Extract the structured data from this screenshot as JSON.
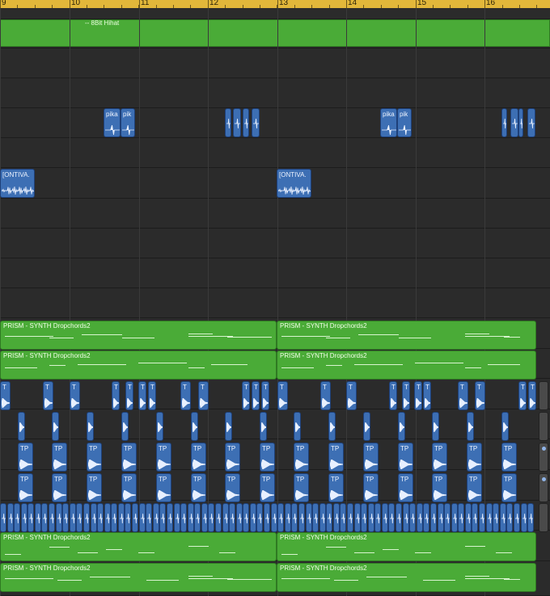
{
  "ruler": {
    "bars": [
      {
        "label": "9"
      },
      {
        "label": "10"
      },
      {
        "label": "11"
      },
      {
        "label": "12"
      },
      {
        "label": "13"
      },
      {
        "label": "14"
      },
      {
        "label": "15"
      },
      {
        "label": "16"
      }
    ]
  },
  "regions": {
    "hihat_label": "-- 8Bit Hihat",
    "pika_a": "pika",
    "pika_b": "pik",
    "ontiva": "[ONTIVA.",
    "prism": "PRISM - SYNTH Dropchords2",
    "t": "T",
    "tp": "TP"
  },
  "colors": {
    "ruler": "#e2b73a",
    "midi_region": "#4aab37",
    "audio_region": "#3d6fb4",
    "background": "#262626"
  }
}
